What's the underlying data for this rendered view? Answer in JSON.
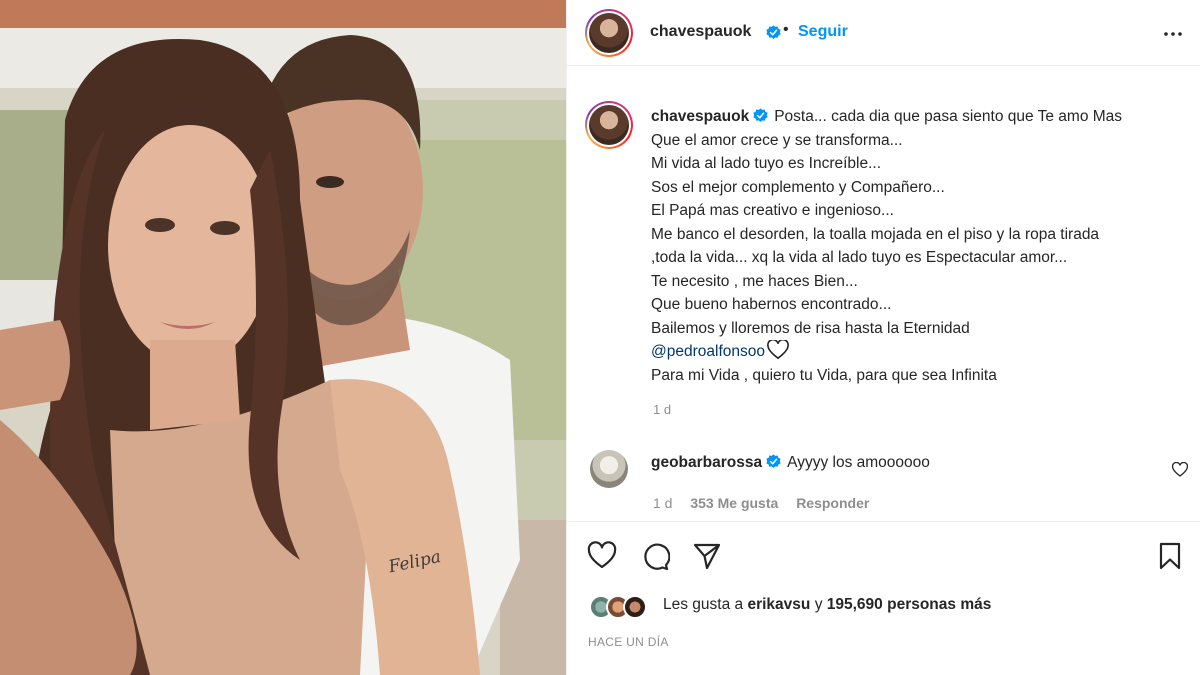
{
  "post": {
    "author": "chavespauok",
    "follow_label": "Seguir",
    "separator": "•",
    "caption_lines": [
      "Posta... cada dia que pasa siento que Te amo Mas",
      "Que el amor crece y se transforma...",
      "Mi vida al lado tuyo es Increíble...",
      "Sos el mejor complemento y Compañero...",
      "El Papá mas creativo e ingenioso...",
      "Me banco el desorden, la toalla mojada en el piso y la ropa tirada",
      ",toda la vida... xq la vida al lado tuyo es Espectacular amor...",
      "Te necesito , me haces Bien...",
      "Que bueno habernos encontrado...",
      "Bailemos y lloremos de risa hasta la Eternidad"
    ],
    "mention": "@pedroalfonsoo",
    "caption_last_line": "Para mi Vida , quiero tu Vida, para que sea Infinita",
    "caption_age": "1 d",
    "photo_tattoo_text": "Felipa"
  },
  "comment": {
    "author": "geobarbarossa",
    "text": "Ayyyy los amoooooo",
    "age": "1 d",
    "likes": "353 Me gusta",
    "reply_label": "Responder"
  },
  "likes": {
    "prefix": "Les gusta a",
    "user": "erikavsu",
    "joiner": "y",
    "others": "195,690 personas más"
  },
  "date_label": "HACE UN DÍA",
  "icons": [
    "more-options-icon",
    "verified-badge-icon",
    "heart-icon",
    "comment-icon",
    "share-icon",
    "bookmark-icon"
  ],
  "colors": {
    "link": "#0095f6",
    "mention": "#00376b",
    "verified": "#0095f6",
    "muted": "#8e8e8e"
  }
}
